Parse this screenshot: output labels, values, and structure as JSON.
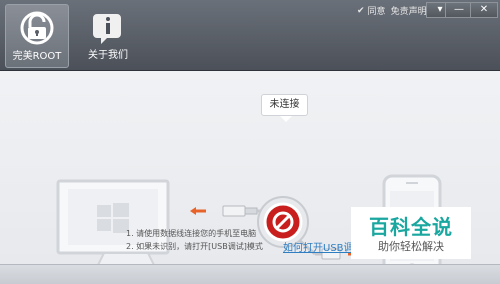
{
  "toolbar": {
    "root_label": "完美ROOT",
    "about_label": "关于我们"
  },
  "window": {
    "agree_label": "同意",
    "disclaimer_label": "免责声明",
    "menu_symbol": "▾",
    "minimize_symbol": "—",
    "close_symbol": "✕"
  },
  "status": {
    "bubble_text": "未连接"
  },
  "instructions": {
    "line1": "1. 请使用数据线连接您的手机至电脑",
    "line2": "2. 如果未识别，请打开[USB调试]模式",
    "link_text": "如何打开USB调"
  },
  "watermark": {
    "title": "百科全说",
    "subtitle": "助你轻松解决"
  },
  "colors": {
    "accent_red": "#c81e1e",
    "arrow_orange": "#e8632a",
    "link_blue": "#2f7ec2",
    "watermark_teal": "#19a7a0"
  }
}
